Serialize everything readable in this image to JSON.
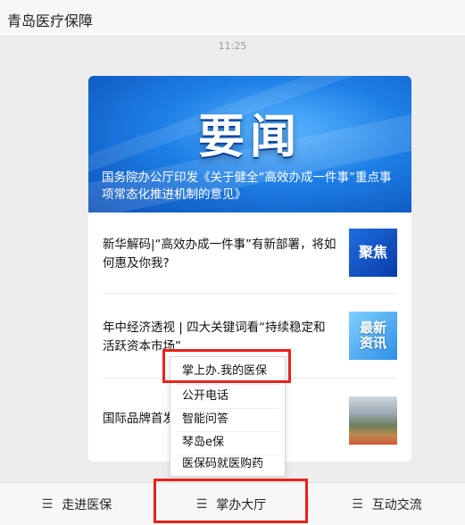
{
  "app": {
    "title": "青岛医疗保障"
  },
  "chat": {
    "timestamp": "11:25"
  },
  "article_card": {
    "banner_title": "要闻",
    "banner_headline": "国务院办公厅印发《关于健全“高效办成一件事”重点事项常态化推进机制的意见》",
    "items": [
      {
        "text": "新华解码|“高效办成一件事”有新部署，将如何惠及你我?",
        "thumb_text": "聚焦"
      },
      {
        "text": "年中经济透视 | 四大关键词看“持续稳定和活跃资本市场”",
        "thumb_text": "最新资讯"
      },
      {
        "text": "国际品牌首发",
        "text_suffix": "]",
        "thumb_text": ""
      }
    ]
  },
  "popup_menu": {
    "items": [
      "掌上办.我的医保",
      "公开电话",
      "智能问答",
      "琴岛e保",
      "医保码就医购药"
    ]
  },
  "bottom_menu": {
    "tabs": [
      {
        "label": "走进医保",
        "icon": "menu-icon"
      },
      {
        "label": "掌办大厅",
        "icon": "menu-icon"
      },
      {
        "label": "互动交流",
        "icon": "menu-icon"
      }
    ]
  },
  "colors": {
    "highlight": "#e8221b",
    "banner": "#1d7fe6"
  }
}
